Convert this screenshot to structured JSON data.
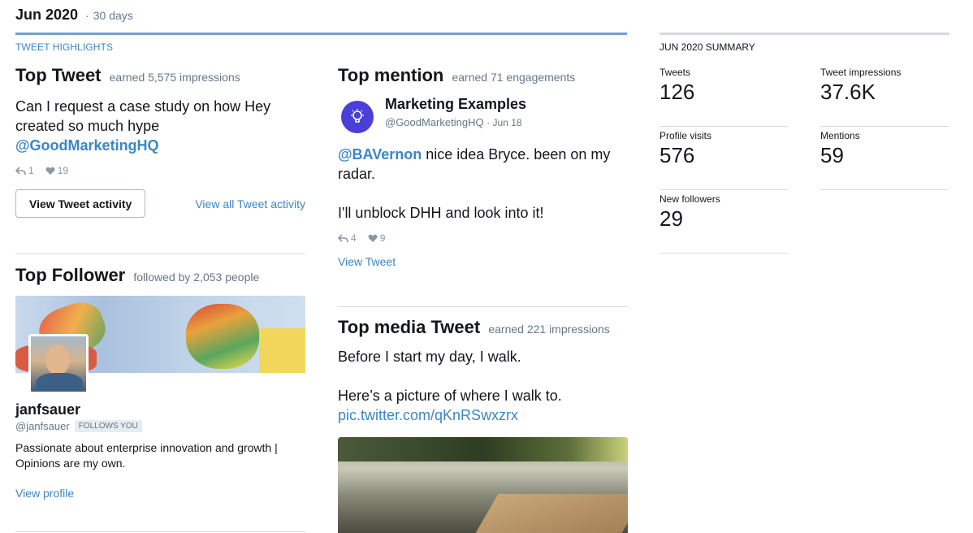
{
  "header": {
    "month": "Jun 2020",
    "separator": "·",
    "period": "30 days",
    "highlights_label": "TWEET HIGHLIGHTS",
    "summary_label": "JUN 2020 SUMMARY"
  },
  "top_tweet": {
    "title": "Top Tweet",
    "subtitle": "earned 5,575 impressions",
    "text": "Can I request a case study on how Hey created so much hype",
    "mention": "@GoodMarketingHQ",
    "replies": "1",
    "likes": "19",
    "button_label": "View Tweet activity",
    "all_link": "View all Tweet activity"
  },
  "top_follower": {
    "title": "Top Follower",
    "subtitle": "followed by 2,053 people",
    "name": "janfsauer",
    "handle": "@janfsauer",
    "badge": "FOLLOWS YOU",
    "bio": "Passionate about enterprise innovation and growth | Opinions are my own.",
    "link": "View profile"
  },
  "top_mention": {
    "title": "Top mention",
    "subtitle": "earned 71 engagements",
    "name": "Marketing Examples",
    "handle": "@GoodMarketingHQ",
    "date": "· Jun 18",
    "mention": "@BAVernon",
    "text1": " nice idea Bryce. been on my radar.",
    "text2": "I'll unblock DHH and look into it!",
    "replies": "4",
    "likes": "9",
    "link": "View Tweet"
  },
  "top_media": {
    "title": "Top media Tweet",
    "subtitle": "earned 221 impressions",
    "text1": "Before I start my day, I walk.",
    "text2": "Here’s a picture of where I walk to.",
    "link": "pic.twitter.com/qKnRSwxzrx"
  },
  "summary": {
    "tweets_label": "Tweets",
    "tweets_value": "126",
    "impressions_label": "Tweet impressions",
    "impressions_value": "37.6K",
    "visits_label": "Profile visits",
    "visits_value": "576",
    "mentions_label": "Mentions",
    "mentions_value": "59",
    "followers_label": "New followers",
    "followers_value": "29"
  },
  "colors": {
    "accent": "#3b86c6",
    "highlight_bar": "#6ea4d8",
    "mention_avatar": "#4a3fd6"
  }
}
